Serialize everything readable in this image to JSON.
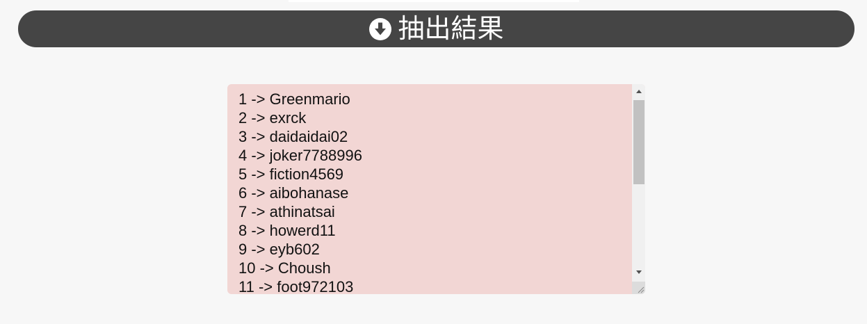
{
  "header": {
    "icon": "circle-arrow-down-icon",
    "title": "抽出結果"
  },
  "results": {
    "lines": [
      "1 -> Greenmario",
      "2 -> exrck",
      "3 -> daidaidai02",
      "4 -> joker7788996",
      "5 -> fiction4569",
      "6 -> aibohanase",
      "7 -> athinatsai",
      "8 -> howerd11",
      "9 -> eyb602",
      "10 -> Choush",
      "11 -> foot972103"
    ]
  },
  "colors": {
    "page_background": "#f7f7f7",
    "header_background": "#454545",
    "header_text": "#ffffff",
    "result_background": "#f2d6d4",
    "result_text": "#111111"
  }
}
